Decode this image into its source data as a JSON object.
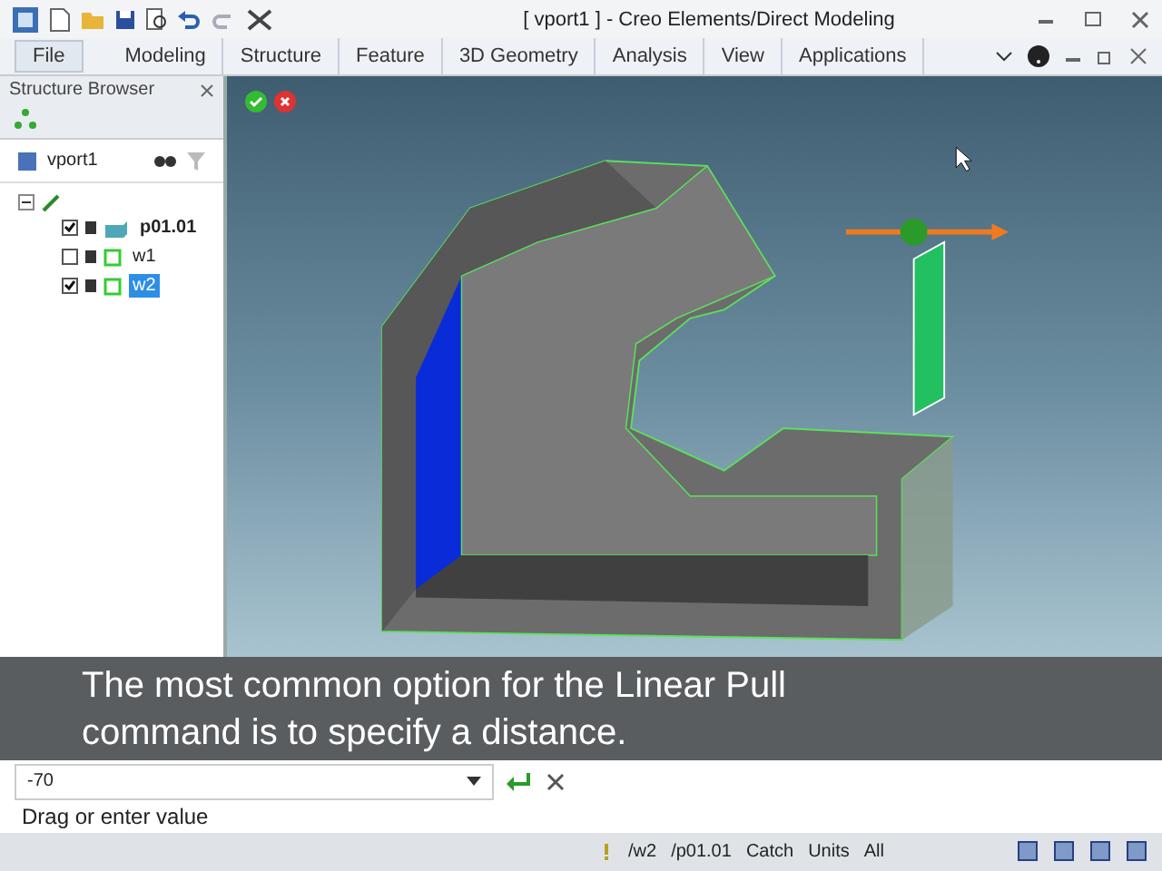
{
  "window": {
    "title": "[ vport1 ] - Creo Elements/Direct Modeling"
  },
  "tabs": [
    {
      "label": "File",
      "kind": "file",
      "selected": false
    },
    {
      "label": "Modeling",
      "kind": "tab",
      "selected": false
    },
    {
      "label": "Structure",
      "kind": "tab",
      "selected": false
    },
    {
      "label": "Feature",
      "kind": "tab",
      "selected": false
    },
    {
      "label": "3D Geometry",
      "kind": "tab",
      "selected": false
    },
    {
      "label": "Analysis",
      "kind": "tab",
      "selected": false
    },
    {
      "label": "View",
      "kind": "tab",
      "selected": false
    },
    {
      "label": "Applications",
      "kind": "tab",
      "selected": false
    }
  ],
  "structure_browser": {
    "title": "Structure Browser",
    "viewport": "vport1",
    "tree": {
      "expanded": true,
      "children": [
        {
          "label": "p01.01",
          "kind": "part",
          "checked": true,
          "selected": false
        },
        {
          "label": "w1",
          "kind": "workplane",
          "checked": false,
          "selected": false
        },
        {
          "label": "w2",
          "kind": "workplane",
          "checked": true,
          "selected": true
        }
      ]
    }
  },
  "command": {
    "value": "-70",
    "prompt": "Drag or enter value"
  },
  "status_bar": {
    "items": [
      "/w2",
      "/p01.01",
      "Catch",
      "Units",
      "All"
    ]
  },
  "subtitle": "The most common option for the Linear Pull command is to specify a distance."
}
